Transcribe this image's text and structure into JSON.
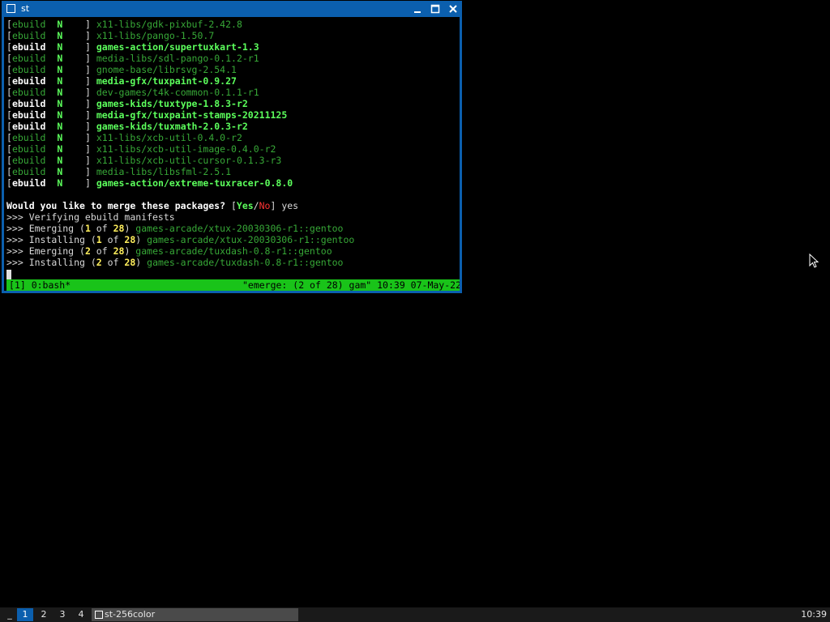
{
  "window": {
    "title": "st",
    "controls": {
      "minimize_icon": "minimize-icon",
      "maximize_icon": "maximize-icon",
      "close_icon": "close-icon"
    }
  },
  "terminal": {
    "ebuild_lines": [
      {
        "tag": "ebuild",
        "flag": "N",
        "pkg": "x11-libs/gdk-pixbuf-2.42.8",
        "highlight": false
      },
      {
        "tag": "ebuild",
        "flag": "N",
        "pkg": "x11-libs/pango-1.50.7",
        "highlight": false
      },
      {
        "tag": "ebuild",
        "flag": "N",
        "pkg": "games-action/supertuxkart-1.3",
        "highlight": true
      },
      {
        "tag": "ebuild",
        "flag": "N",
        "pkg": "media-libs/sdl-pango-0.1.2-r1",
        "highlight": false
      },
      {
        "tag": "ebuild",
        "flag": "N",
        "pkg": "gnome-base/librsvg-2.54.1",
        "highlight": false
      },
      {
        "tag": "ebuild",
        "flag": "N",
        "pkg": "media-gfx/tuxpaint-0.9.27",
        "highlight": true
      },
      {
        "tag": "ebuild",
        "flag": "N",
        "pkg": "dev-games/t4k-common-0.1.1-r1",
        "highlight": false
      },
      {
        "tag": "ebuild",
        "flag": "N",
        "pkg": "games-kids/tuxtype-1.8.3-r2",
        "highlight": true
      },
      {
        "tag": "ebuild",
        "flag": "N",
        "pkg": "media-gfx/tuxpaint-stamps-20211125",
        "highlight": true
      },
      {
        "tag": "ebuild",
        "flag": "N",
        "pkg": "games-kids/tuxmath-2.0.3-r2",
        "highlight": true
      },
      {
        "tag": "ebuild",
        "flag": "N",
        "pkg": "x11-libs/xcb-util-0.4.0-r2",
        "highlight": false
      },
      {
        "tag": "ebuild",
        "flag": "N",
        "pkg": "x11-libs/xcb-util-image-0.4.0-r2",
        "highlight": false
      },
      {
        "tag": "ebuild",
        "flag": "N",
        "pkg": "x11-libs/xcb-util-cursor-0.1.3-r3",
        "highlight": false
      },
      {
        "tag": "ebuild",
        "flag": "N",
        "pkg": "media-libs/libsfml-2.5.1",
        "highlight": false
      },
      {
        "tag": "ebuild",
        "flag": "N",
        "pkg": "games-action/extreme-tuxracer-0.8.0",
        "highlight": true
      }
    ],
    "prompt": {
      "question": "Would you like to merge these packages?",
      "yes": "Yes",
      "no": "No",
      "answer": "yes"
    },
    "verify_line": ">>> Verifying ebuild manifests",
    "progress_lines": [
      {
        "prefix": ">>> ",
        "action": "Emerging",
        "current": "1",
        "total": "28",
        "pkg": "games-arcade/xtux-20030306-r1::gentoo"
      },
      {
        "prefix": ">>> ",
        "action": "Installing",
        "current": "1",
        "total": "28",
        "pkg": "games-arcade/xtux-20030306-r1::gentoo"
      },
      {
        "prefix": ">>> ",
        "action": "Emerging",
        "current": "2",
        "total": "28",
        "pkg": "games-arcade/tuxdash-0.8-r1::gentoo"
      },
      {
        "prefix": ">>> ",
        "action": "Installing",
        "current": "2",
        "total": "28",
        "pkg": "games-arcade/tuxdash-0.8-r1::gentoo"
      }
    ]
  },
  "tmux_status": {
    "left": "[1] 0:bash*",
    "right": "\"emerge: (2 of 28) gam\" 10:39 07-May-22"
  },
  "panel": {
    "menu_label": "_",
    "workspaces": [
      "1",
      "2",
      "3",
      "4"
    ],
    "active_workspace": "1",
    "task_label": "st-256color",
    "clock": "10:39"
  }
}
